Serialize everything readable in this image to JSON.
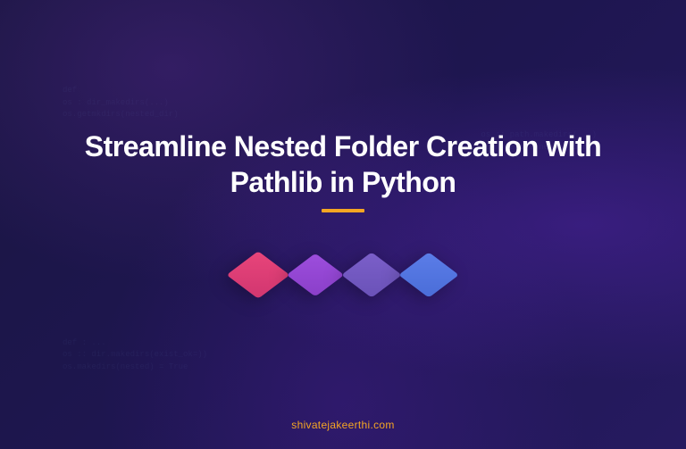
{
  "title_line1": "Streamline Nested Folder Creation with",
  "title_line2": "Pathlib in Python",
  "footer_url": "shivatejakeerthi.com",
  "code_snippet_1": "def \nos : dir_makedirs(...)\nos.getmkdirs(nested_dir)",
  "code_snippet_2": "os :: path.makedirs(...)\nos.makedirs(nested_dir)",
  "code_snippet_3": "def : ...\nos :: dir.makedirs(exist_ok=))\nos.makedirs(nested) = True"
}
